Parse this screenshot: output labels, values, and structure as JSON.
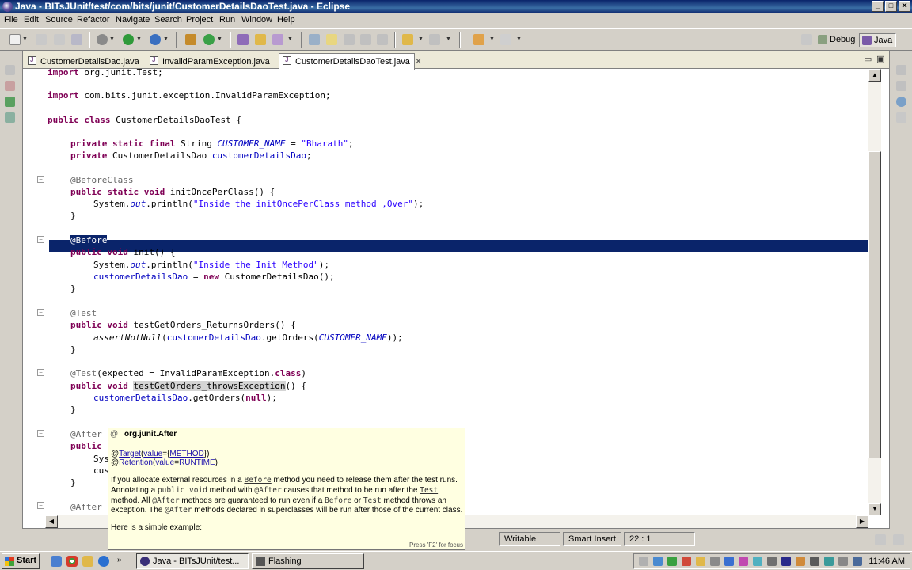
{
  "window": {
    "title": "Java - BITsJUnit/test/com/bits/junit/CustomerDetailsDaoTest.java - Eclipse"
  },
  "menu": [
    "File",
    "Edit",
    "Source",
    "Refactor",
    "Navigate",
    "Search",
    "Project",
    "Run",
    "Window",
    "Help"
  ],
  "perspectives": {
    "debug": "Debug",
    "java": "Java"
  },
  "tabs": [
    {
      "label": "CustomerDetailsDao.java"
    },
    {
      "label": "InvalidParamException.java"
    },
    {
      "label": "CustomerDetailsDaoTest.java",
      "close": "✕"
    }
  ],
  "code": {
    "l1": "import org.junit.Test;",
    "l2_kw": "import",
    "l2_rest": " com.bits.junit.exception.InvalidParamException;",
    "l3_kw": "public class",
    "l3_rest": " CustomerDetailsDaoTest {",
    "l4_kw": "private static final",
    "l4_a": " String ",
    "l4_fld": "CUSTOMER_NAME",
    "l4_b": " = ",
    "l4_str": "\"Bharath\"",
    "l4_c": ";",
    "l5_kw": "private",
    "l5_a": " CustomerDetailsDao ",
    "l5_fld": "customerDetailsDao",
    "l5_c": ";",
    "l6": "@BeforeClass",
    "l7_kw": "public static void",
    "l7_rest": " initOncePerClass() {",
    "l8_a": "System.",
    "l8_fld": "out",
    "l8_b": ".println(",
    "l8_str": "\"Inside the initOncePerClass method ,Over\"",
    "l8_c": ");",
    "brace": "}",
    "l9": "@Before",
    "l10_kw": "public void",
    "l10_rest": " init() {",
    "l11_a": "System.",
    "l11_fld": "out",
    "l11_b": ".println(",
    "l11_str": "\"Inside the Init Method\"",
    "l11_c": ");",
    "l12_fld": "customerDetailsDao",
    "l12_a": " = ",
    "l12_kw": "new",
    "l12_b": " CustomerDetailsDao();",
    "l13": "@Test",
    "l14_kw": "public void",
    "l14_rest": " testGetOrders_ReturnsOrders() {",
    "l15_it": "assertNotNull",
    "l15_a": "(",
    "l15_fld": "customerDetailsDao",
    "l15_b": ".getOrders(",
    "l15_fld2": "CUSTOMER_NAME",
    "l15_c": "));",
    "l16_ann": "@Test",
    "l16_a": "(expected = InvalidParamException.",
    "l16_kw": "class",
    "l16_b": ")",
    "l17_kw": "public void",
    "l17_sp": " ",
    "l17_occ": "testGetOrders_throwsException",
    "l17_rest": "() {",
    "l18_fld": "customerDetailsDao",
    "l18_a": ".getOrders(",
    "l18_kw": "null",
    "l18_b": ");",
    "l19": "@After",
    "l20": "public",
    "l21": "Sys",
    "l22": "cus",
    "l23": "@After"
  },
  "popup": {
    "title": "org.junit.After",
    "target_pre": "@",
    "target": "Target",
    "target_mid": "(",
    "target_val": "value",
    "target_eq": "={",
    "target_method": "METHOD",
    "target_end": "})",
    "ret_pre": "@",
    "ret": "Retention",
    "ret_mid": "(",
    "ret_val": "value",
    "ret_eq": "=",
    "ret_rt": "RUNTIME",
    "ret_end": ")",
    "p1a": "If you allocate external resources in a ",
    "p1_link": "Before",
    "p1b": " method you need to release them after the test runs.",
    "p2a": "Annotating a ",
    "p2_code": "public void",
    "p2b": " method with ",
    "p2_code2": "@After",
    "p2c": " causes that method to be run after the ",
    "p2_link": "Test",
    "p3a": "method. All ",
    "p3_code": "@After",
    "p3b": " methods are guaranteed to run even if a ",
    "p3_link": "Before",
    "p3c": " or ",
    "p3_link2": "Test",
    "p3d": " method throws an",
    "p4a": "exception. The ",
    "p4_code": "@After",
    "p4b": " methods declared in superclasses will be run after those of the current class.",
    "p5": "Here is a simple example:",
    "footer": "Press 'F2' for focus"
  },
  "status": {
    "writable": "Writable",
    "insert_mode": "Smart Insert",
    "position": "22 : 1"
  },
  "taskbar": {
    "start": "Start",
    "tasks": [
      {
        "label": "Java - BITsJUnit/test..."
      },
      {
        "label": "Flashing"
      }
    ],
    "clock": "11:46 AM"
  },
  "colors": {
    "keyword": "#7f0055",
    "string": "#2a00ff",
    "field": "#0000c0",
    "annotation": "#646464",
    "selection": "#0a246a"
  }
}
